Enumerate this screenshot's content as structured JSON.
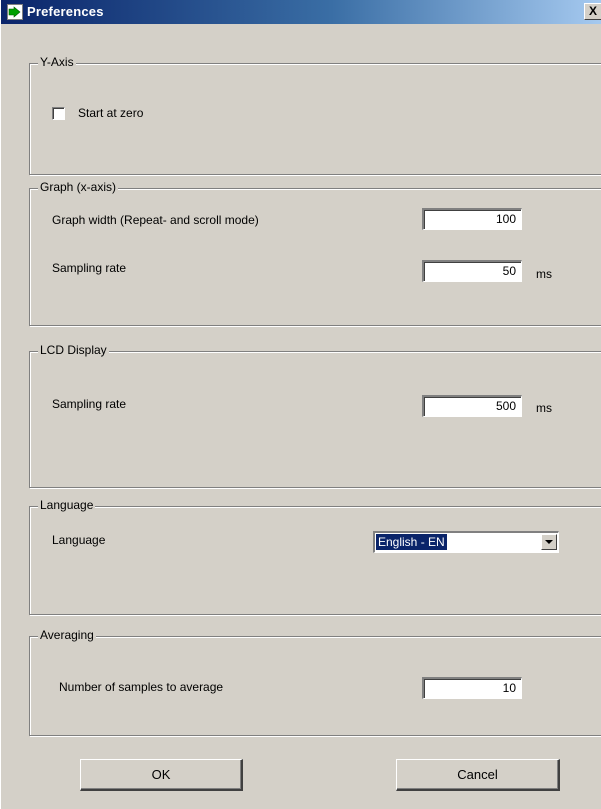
{
  "window": {
    "title": "Preferences",
    "close_glyph": "X"
  },
  "y_axis": {
    "group_label": "Y-Axis",
    "start_at_zero_label": "Start at zero",
    "start_at_zero_checked": false
  },
  "graph": {
    "group_label": "Graph (x-axis)",
    "width_label": "Graph width (Repeat- and scroll mode)",
    "width_value": "100",
    "sampling_label": "Sampling rate",
    "sampling_value": "50",
    "sampling_unit": "ms"
  },
  "lcd": {
    "group_label": "LCD Display",
    "sampling_label": "Sampling rate",
    "sampling_value": "500",
    "sampling_unit": "ms"
  },
  "language": {
    "group_label": "Language",
    "label": "Language",
    "selected": "English - EN"
  },
  "averaging": {
    "group_label": "Averaging",
    "samples_label": "Number of samples to average",
    "samples_value": "10"
  },
  "buttons": {
    "ok": "OK",
    "cancel": "Cancel"
  },
  "colors": {
    "titlebar_start": "#0a246a",
    "titlebar_end": "#a6caf0",
    "face": "#d4d0c8",
    "selection": "#0a246a"
  },
  "icons": {
    "title": "app-arrow-icon",
    "close": "close-icon",
    "dropdown": "chevron-down-icon"
  }
}
